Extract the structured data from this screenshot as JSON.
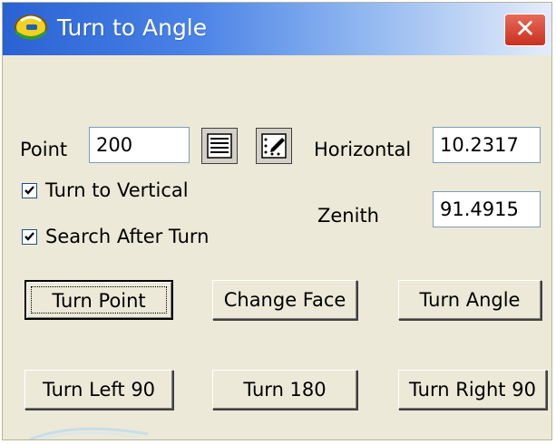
{
  "window": {
    "title": "Turn to Angle",
    "close_glyph": "✕",
    "icon": "surveyor-hardhat-icon"
  },
  "point": {
    "label": "Point",
    "value": "200",
    "list_icon": "list-icon",
    "map_icon": "map-select-icon"
  },
  "horizontal": {
    "label": "Horizontal",
    "value": "10.2317"
  },
  "zenith": {
    "label": "Zenith",
    "value": "91.4915"
  },
  "checkboxes": [
    {
      "label": "Turn to Vertical",
      "checked": true
    },
    {
      "label": "Search After Turn",
      "checked": true
    }
  ],
  "buttons": {
    "turn_point": "Turn Point",
    "change_face": "Change Face",
    "turn_angle": "Turn Angle",
    "turn_left_90": "Turn Left 90",
    "turn_180": "Turn 180",
    "turn_right_90": "Turn Right 90"
  },
  "colors": {
    "titlebar": "#2a62d4",
    "close": "#c9301e",
    "face": "#ece9d8"
  }
}
